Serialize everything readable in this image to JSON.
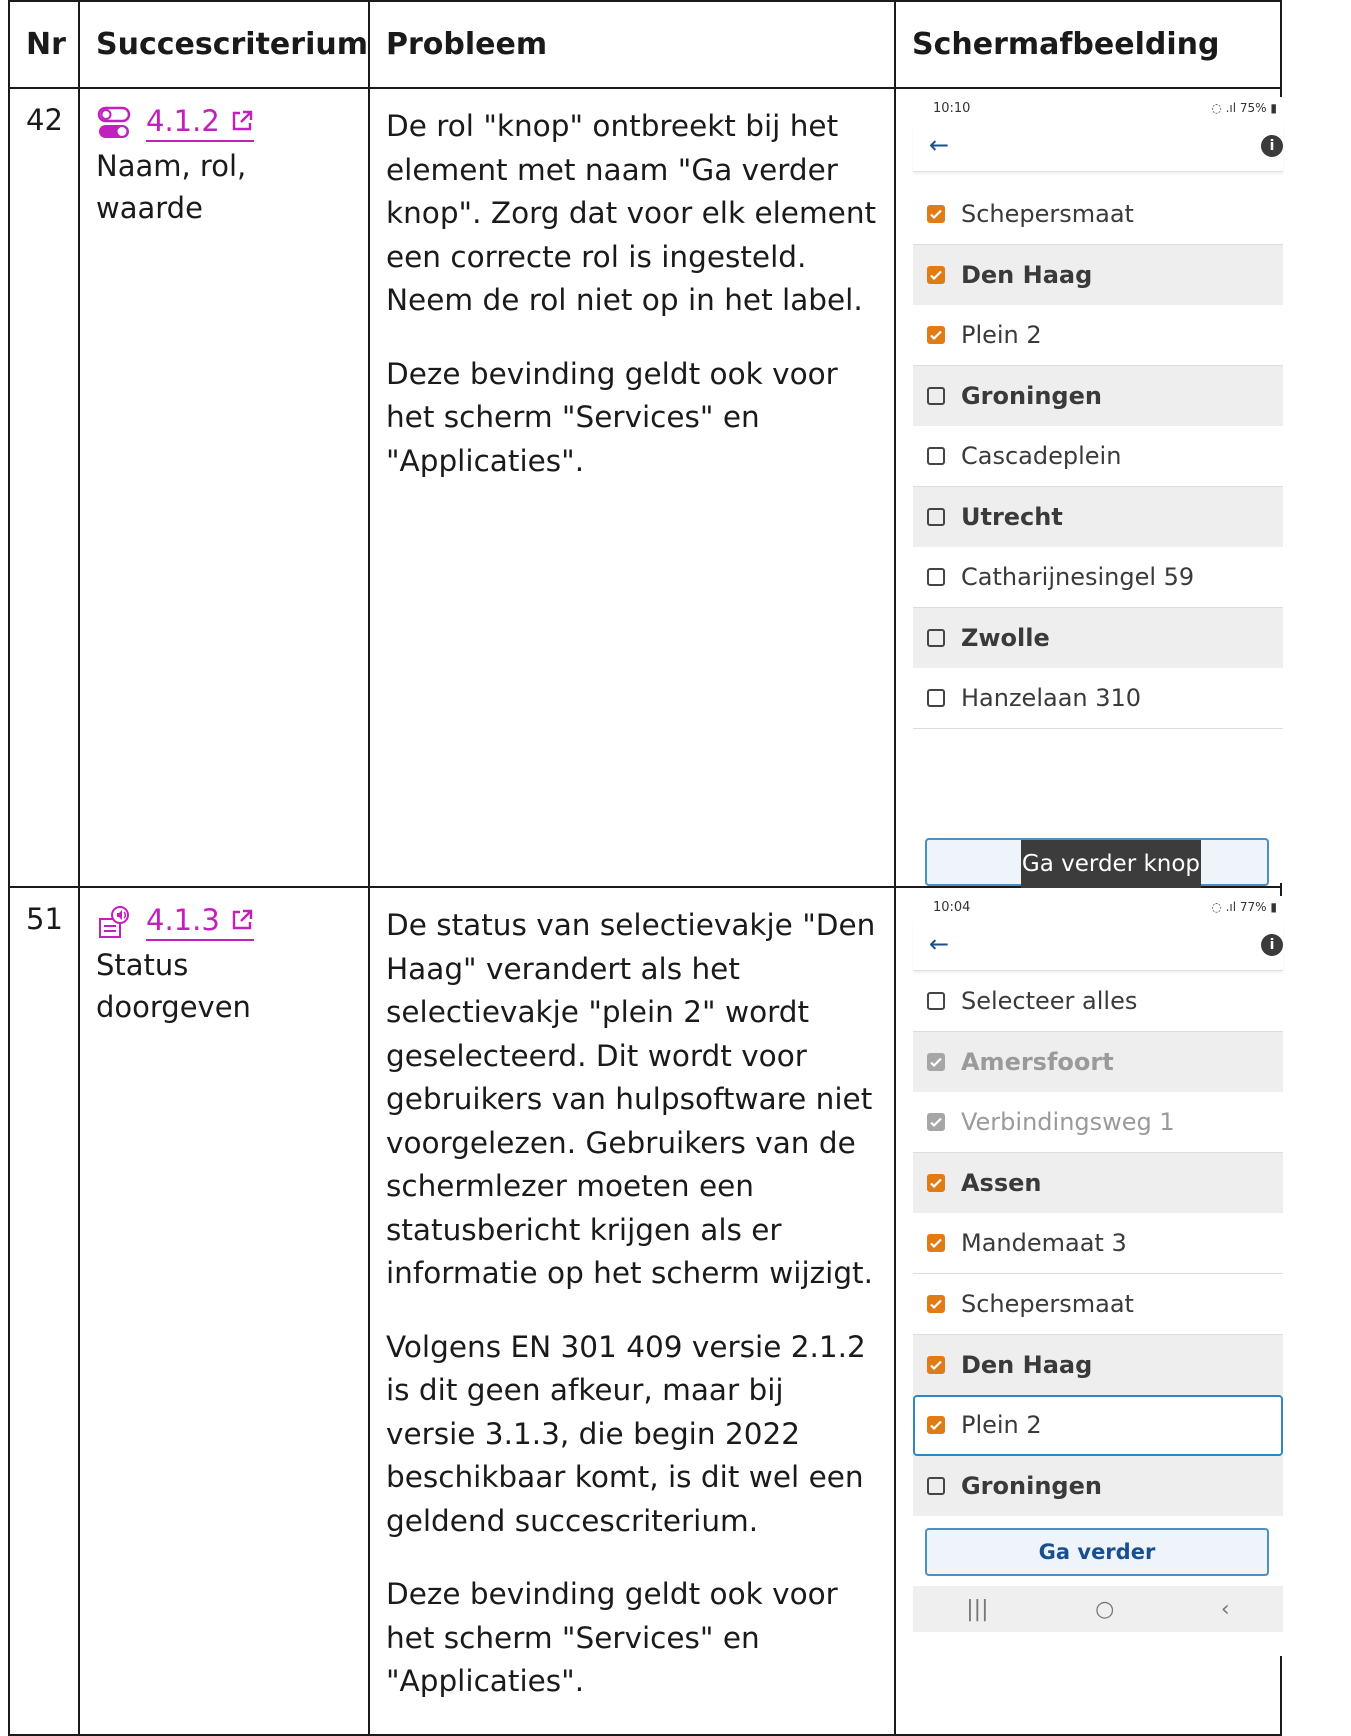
{
  "table": {
    "headers": {
      "nr": "Nr",
      "criterion": "Succescriterium",
      "problem": "Probleem",
      "screenshot": "Schermafbeelding"
    },
    "rows": [
      {
        "nr": "42",
        "icon": "toggle-switch-icon",
        "sc_link": "4.1.2",
        "sc_name": "Naam, rol, waarde",
        "problem_paragraphs": [
          "De rol \"knop\" ontbreekt bij het element met naam \"Ga verder knop\". Zorg dat voor elk element een correcte rol is ingesteld. Neem de rol niet op in het label.",
          "Deze bevinding geldt ook voor het scherm \"Services\" en \"Applicaties\"."
        ],
        "phone": {
          "time": "10:10",
          "status": "75%",
          "items": [
            {
              "label": "Schepersmaat",
              "type": "item",
              "state": "checked"
            },
            {
              "label": "Den Haag",
              "type": "group",
              "state": "checked"
            },
            {
              "label": "Plein 2",
              "type": "item",
              "state": "checked"
            },
            {
              "label": "Groningen",
              "type": "group",
              "state": "unchecked"
            },
            {
              "label": "Cascadeplein",
              "type": "item",
              "state": "unchecked"
            },
            {
              "label": "Utrecht",
              "type": "group",
              "state": "unchecked"
            },
            {
              "label": "Catharijnesingel 59",
              "type": "item",
              "state": "unchecked"
            },
            {
              "label": "Zwolle",
              "type": "group",
              "state": "unchecked"
            },
            {
              "label": "Hanzelaan 310",
              "type": "item",
              "state": "unchecked"
            }
          ],
          "button_label": "",
          "tooltip": "Ga verder knop"
        }
      },
      {
        "nr": "51",
        "icon": "speaker-document-icon",
        "sc_link": "4.1.3",
        "sc_name": "Status doorgeven",
        "problem_paragraphs": [
          "De status van selectievakje \"Den Haag\" verandert als het selectievakje \"plein 2\" wordt geselecteerd. Dit wordt voor gebruikers van hulpsoftware niet voorgelezen. Gebruikers van de schermlezer moeten een statusbericht krijgen als er informatie op het scherm wijzigt.",
          "Volgens EN 301 409 versie 2.1.2 is dit geen afkeur, maar bij versie 3.1.3, die begin 2022 beschikbaar komt, is dit wel een geldend succescriterium.",
          "Deze bevinding geldt ook voor het scherm \"Services\" en \"Applicaties\"."
        ],
        "phone": {
          "time": "10:04",
          "status": "77%",
          "items": [
            {
              "label": "Selecteer alles",
              "type": "item",
              "state": "unchecked"
            },
            {
              "label": "Amersfoort",
              "type": "group",
              "state": "disabled"
            },
            {
              "label": "Verbindingsweg 1",
              "type": "item",
              "state": "disabled"
            },
            {
              "label": "Assen",
              "type": "group",
              "state": "checked"
            },
            {
              "label": "Mandemaat 3",
              "type": "item",
              "state": "checked"
            },
            {
              "label": "Schepersmaat",
              "type": "item",
              "state": "checked"
            },
            {
              "label": "Den Haag",
              "type": "group",
              "state": "checked"
            },
            {
              "label": "Plein 2",
              "type": "item",
              "state": "checked",
              "focused": true
            },
            {
              "label": "Groningen",
              "type": "group",
              "state": "unchecked"
            }
          ],
          "button_label": "Ga verder",
          "tooltip": ""
        }
      }
    ]
  },
  "colors": {
    "link": "#c21fbe",
    "checkbox_checked": "#e07b16",
    "focus": "#2f86c7"
  }
}
